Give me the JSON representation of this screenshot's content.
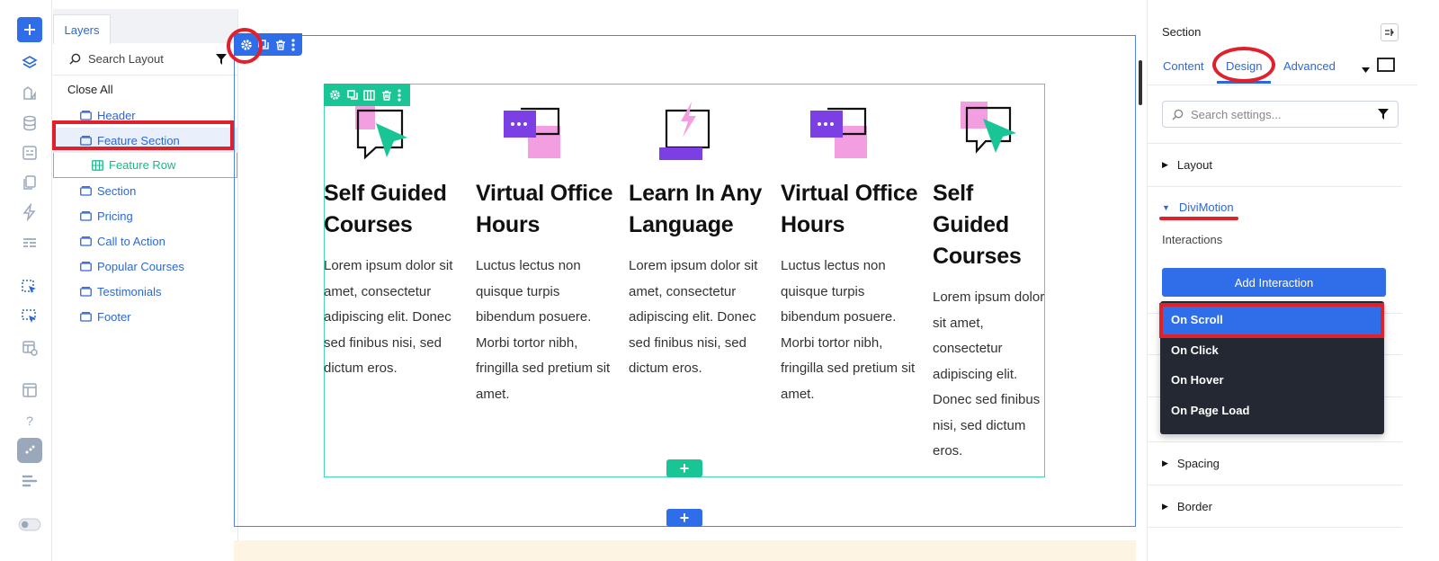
{
  "toolbar": {
    "icons": [
      "add-icon",
      "layers-icon",
      "modules-icon",
      "database-icon",
      "form-icon",
      "pages-icon",
      "bolt-icon",
      "list-icon",
      "select-cursor-icon",
      "select-cursor-alt-icon",
      "layout-settings-icon",
      "window-icon",
      "help-icon",
      "theme-icon",
      "align-icon",
      "toggle-icon"
    ],
    "help_label": "?"
  },
  "layers": {
    "tab_label": "Layers",
    "search_placeholder": "Search Layout",
    "close_all": "Close All",
    "items": [
      {
        "label": "Header"
      },
      {
        "label": "Feature Section"
      },
      {
        "label": "Feature Row"
      },
      {
        "label": "Section"
      },
      {
        "label": "Pricing"
      },
      {
        "label": "Call to Action"
      },
      {
        "label": "Popular Courses"
      },
      {
        "label": "Testimonials"
      },
      {
        "label": "Footer"
      }
    ]
  },
  "canvas": {
    "columns": [
      {
        "title": "Self Guided Courses",
        "body": "Lorem ipsum dolor sit amet, consectetur adipiscing elit. Donec sed finibus nisi, sed dictum eros.",
        "icon": "chat-cursor-icon"
      },
      {
        "title": "Virtual Office Hours",
        "body": "Luctus lectus non quisque turpis bibendum posuere. Morbi tortor nibh, fringilla sed pretium sit amet.",
        "icon": "chat-bubbles-icon"
      },
      {
        "title": "Learn In Any Language",
        "body": "Lorem ipsum dolor sit amet, consectetur adipiscing elit. Donec sed finibus nisi, sed dictum eros.",
        "icon": "chat-bolt-icon"
      },
      {
        "title": "Virtual Office Hours",
        "body": "Luctus lectus non quisque turpis bibendum posuere. Morbi tortor nibh, fringilla sed pretium sit amet.",
        "icon": "chat-bubbles-icon"
      },
      {
        "title": "Self Guided Courses",
        "body": "Lorem ipsum dolor sit amet, consectetur adipiscing elit. Donec sed finibus nisi, sed dictum eros.",
        "icon": "chat-cursor-icon"
      }
    ],
    "add_label": "+"
  },
  "settings": {
    "title": "Section",
    "tabs": [
      "Content",
      "Design",
      "Advanced"
    ],
    "search_placeholder": "Search settings...",
    "groups": [
      "Layout",
      "DiviMotion",
      "Spacing",
      "Border"
    ],
    "interactions_label": "Interactions",
    "add_interaction": "Add Interaction",
    "dropdown": [
      "On Scroll",
      "On Click",
      "On Hover",
      "On Page Load"
    ]
  },
  "colors": {
    "accent": "#2f6de9",
    "row_accent": "#19c495",
    "highlight": "#e0212b",
    "dropdown_bg": "#232833",
    "purple": "#7b3fe4",
    "pink": "#f39ee0",
    "green": "#19c495"
  }
}
